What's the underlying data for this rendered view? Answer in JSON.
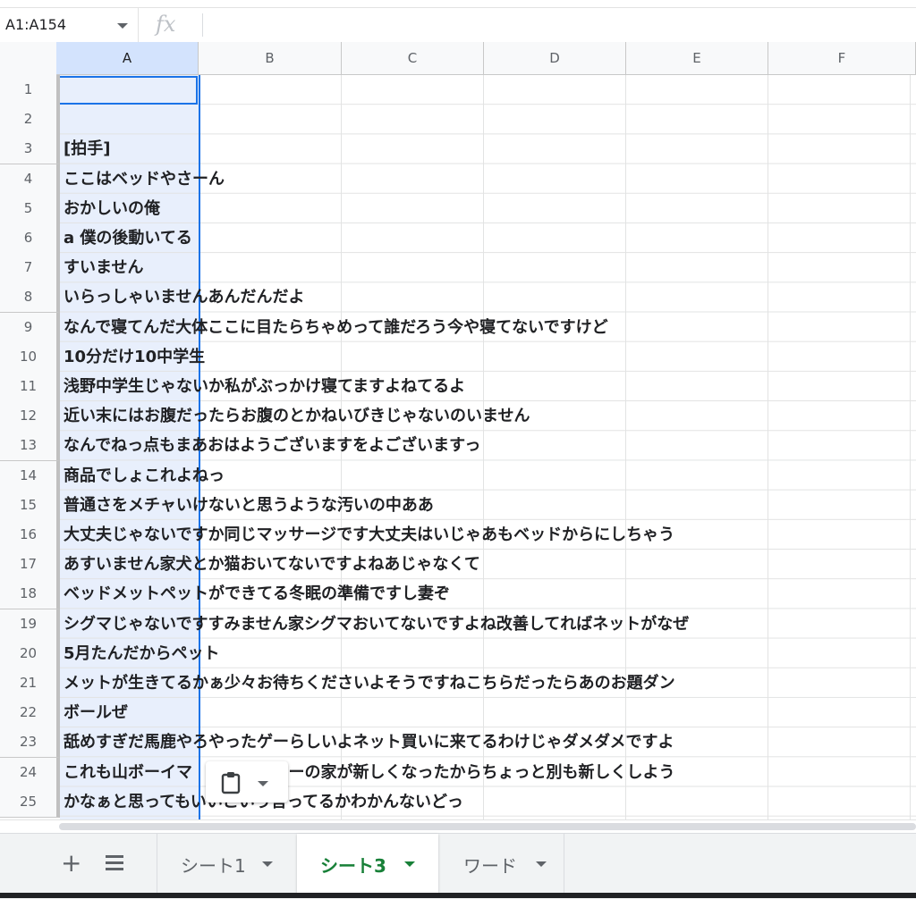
{
  "formula_bar": {
    "name_box": "A1:A154",
    "fx_icon": "function-icon"
  },
  "columns": [
    "A",
    "B",
    "C",
    "D",
    "E",
    "F"
  ],
  "rows": [
    {
      "num": "1",
      "text": ""
    },
    {
      "num": "2",
      "text": ""
    },
    {
      "num": "3",
      "text": "[拍手]"
    },
    {
      "num": "4",
      "text": "ここはベッドやさーん"
    },
    {
      "num": "5",
      "text": "おかしいの俺"
    },
    {
      "num": "6",
      "text": "a 僕の後動いてる"
    },
    {
      "num": "7",
      "text": "すいません"
    },
    {
      "num": "8",
      "text": "いらっしゃいませんあんだんだよ"
    },
    {
      "num": "9",
      "text": "なんで寝てんだ大体ここに目たらちゃめって誰だろう今や寝てないですけど"
    },
    {
      "num": "10",
      "text": "10分だけ10中学生"
    },
    {
      "num": "11",
      "text": "浅野中学生じゃないか私がぶっかけ寝てますよねてるよ"
    },
    {
      "num": "12",
      "text": "近い末にはお腹だったらお腹のとかねいびきじゃないのいません"
    },
    {
      "num": "13",
      "text": "なんでねっ点もまあおはようございますをよございますっ"
    },
    {
      "num": "14",
      "text": "商品でしょこれよねっ"
    },
    {
      "num": "15",
      "text": "普通さをメチャいけないと思うような汚いの中ああ"
    },
    {
      "num": "16",
      "text": "大丈夫じゃないですか同じマッサージです大丈夫はいじゃあもベッドからにしちゃう"
    },
    {
      "num": "17",
      "text": "あすいません家犬とか猫おいてないですよねあじゃなくて"
    },
    {
      "num": "18",
      "text": "ベッドメットペットができてる冬眠の準備ですし妻ぞ"
    },
    {
      "num": "19",
      "text": "シグマじゃないですすみません家シグマおいてないですよね改善してればネットがなぜ"
    },
    {
      "num": "20",
      "text": "5月たんだからペット"
    },
    {
      "num": "21",
      "text": "メットが生きてるかぁ少々お待ちくださいよそうですねこちらだったらあのお題ダン"
    },
    {
      "num": "22",
      "text": "ボールぜ"
    },
    {
      "num": "23",
      "text": "舐めすぎだ馬鹿やろやったゲーらしいよネット買いに来てるわけじゃダメダメですよ"
    },
    {
      "num": "24",
      "text": "これも山ボーイマ　　　ッイヤーの家が新しくなったからちょっと別も新しくしよう"
    },
    {
      "num": "25",
      "text": "かなぁと思ってもいいこいう言ってるかわかんないどっ"
    }
  ],
  "paste_popup": {
    "icon": "clipboard-icon"
  },
  "tabs": {
    "add_icon": "+",
    "sheets": [
      {
        "label": "シート1",
        "active": false
      },
      {
        "label": "シート3",
        "active": true
      },
      {
        "label": "ワード",
        "active": false
      }
    ]
  },
  "colors": {
    "selection": "#1a73e8",
    "selection_fill": "#e8effc",
    "active_tab": "#188038"
  }
}
